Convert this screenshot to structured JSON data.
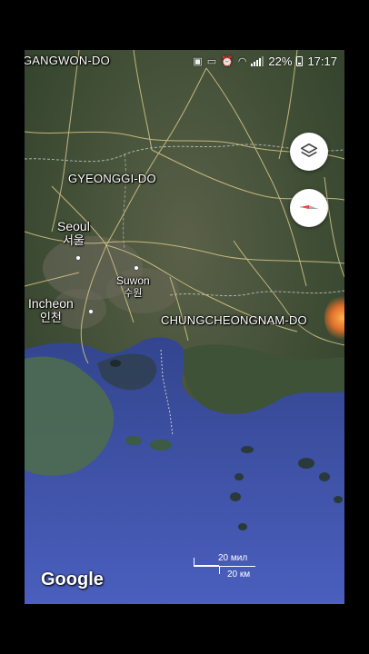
{
  "status_bar": {
    "battery": "22%",
    "time": "17:17",
    "icons": [
      "photo-icon",
      "cast-icon",
      "alarm-icon",
      "wifi-icon",
      "signal-icon",
      "battery-icon"
    ]
  },
  "map": {
    "provinces": {
      "gangwon": "GANGWON-DO",
      "gyeonggi": "GYEONGGI-DO",
      "chungcheongnam": "CHUNGCHEONGNAM-DO"
    },
    "cities": {
      "seoul": {
        "en": "Seoul",
        "ko": "서울"
      },
      "suwon": {
        "en": "Suwon",
        "ko": "수원"
      },
      "incheon": {
        "en": "Incheon",
        "ko": "인천"
      }
    },
    "layers_icon": "layers-icon",
    "compass_icon": "compass-icon",
    "brand": "Google",
    "scale": {
      "top": "20 мил",
      "bottom": "20 км"
    },
    "colors": {
      "land": "#3c4a34",
      "sea": "#3e52a8",
      "road": "#d9c88a",
      "border": "#bbbbbb"
    }
  }
}
